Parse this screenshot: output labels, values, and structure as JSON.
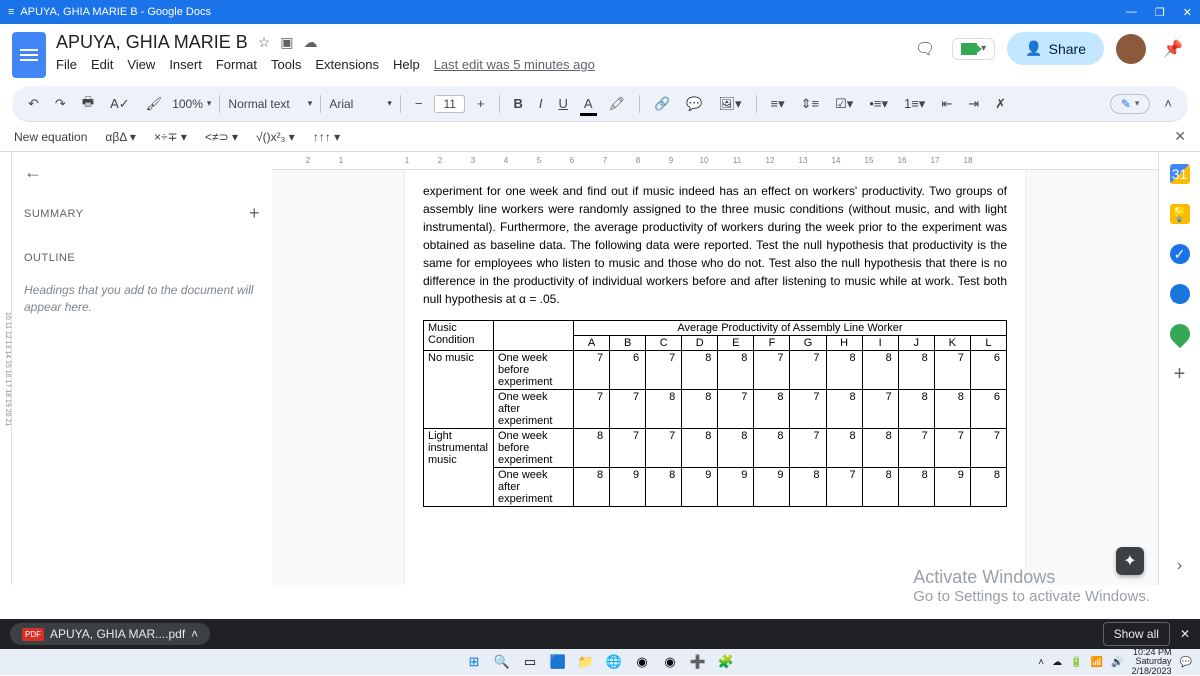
{
  "browser": {
    "tab_title": "APUYA, GHIA MARIE B - Google Docs"
  },
  "header": {
    "doc_title": "APUYA, GHIA MARIE B",
    "menus": [
      "File",
      "Edit",
      "View",
      "Insert",
      "Format",
      "Tools",
      "Extensions",
      "Help"
    ],
    "last_edit": "Last edit was 5 minutes ago",
    "share_label": "Share"
  },
  "toolbar": {
    "zoom": "100%",
    "style": "Normal text",
    "font": "Arial",
    "font_size": "11"
  },
  "equation_bar": {
    "label": "New equation",
    "groups": [
      "αβΔ ▾",
      "×÷∓ ▾",
      "<≠⊃ ▾",
      "√()x²₃ ▾",
      "↑↑↑ ▾"
    ]
  },
  "ruler_top": [
    "2",
    "1",
    "",
    "1",
    "2",
    "3",
    "4",
    "5",
    "6",
    "7",
    "8",
    "9",
    "10",
    "11",
    "12",
    "13",
    "14",
    "15",
    "16",
    "17",
    "18"
  ],
  "outline": {
    "summary": "SUMMARY",
    "outline_label": "OUTLINE",
    "hint": "Headings that you add to the document will appear here."
  },
  "document": {
    "paragraph": "experiment for one week and find out if music indeed has an effect on workers' productivity. Two groups of assembly line workers were randomly assigned to the three music conditions (without music, and with light instrumental). Furthermore, the average productivity of workers during the week prior to the experiment was obtained as baseline data. The following data were reported. Test the null hypothesis that productivity is the same for employees who listen to music and those who do not. Test also the null hypothesis that there is no difference in the productivity of individual workers before and after listening to music while at work. Test both null hypothesis at α = .05.",
    "table": {
      "corner": "Music Condition",
      "avg_header": "Average Productivity of Assembly Line Worker",
      "workers": [
        "A",
        "B",
        "C",
        "D",
        "E",
        "F",
        "G",
        "H",
        "I",
        "J",
        "K",
        "L"
      ],
      "groups": [
        {
          "label": "No music",
          "rows": [
            {
              "label": "One week before experiment",
              "vals": [
                7,
                6,
                7,
                8,
                8,
                7,
                7,
                8,
                8,
                8,
                7,
                6
              ]
            },
            {
              "label": "One week after experiment",
              "vals": [
                7,
                7,
                8,
                8,
                7,
                8,
                7,
                8,
                7,
                8,
                8,
                6
              ]
            }
          ]
        },
        {
          "label": "Light instrumental music",
          "rows": [
            {
              "label": "One week before experiment",
              "vals": [
                8,
                7,
                7,
                8,
                8,
                8,
                7,
                8,
                8,
                7,
                7,
                7
              ]
            },
            {
              "label": "One week after experiment",
              "vals": [
                8,
                9,
                8,
                9,
                9,
                9,
                8,
                7,
                8,
                8,
                9,
                8
              ]
            }
          ]
        }
      ]
    }
  },
  "watermark": {
    "l1": "Activate Windows",
    "l2": "Go to Settings to activate Windows."
  },
  "download": {
    "file": "APUYA, GHIA MAR....pdf",
    "show_all": "Show all"
  },
  "clock": {
    "time": "10:24 PM",
    "day": "Saturday",
    "date": "2/18/2023"
  }
}
